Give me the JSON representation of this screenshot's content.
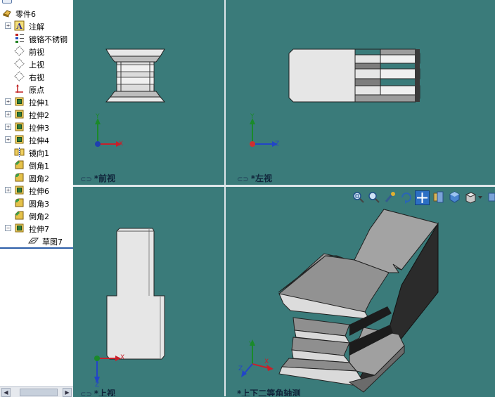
{
  "tree": {
    "items": [
      {
        "label": "零件6",
        "icon": "part-icon",
        "expander": ""
      },
      {
        "label": "注解",
        "icon": "annotation-icon",
        "expander": "+"
      },
      {
        "label": "镀铬不锈钢",
        "icon": "material-icon",
        "expander": ""
      },
      {
        "label": "前视",
        "icon": "plane-icon",
        "expander": ""
      },
      {
        "label": "上视",
        "icon": "plane-icon",
        "expander": ""
      },
      {
        "label": "右视",
        "icon": "plane-icon",
        "expander": ""
      },
      {
        "label": "原点",
        "icon": "origin-icon",
        "expander": ""
      },
      {
        "label": "拉伸1",
        "icon": "extrude-icon",
        "expander": "+"
      },
      {
        "label": "拉伸2",
        "icon": "extrude-icon",
        "expander": "+"
      },
      {
        "label": "拉伸3",
        "icon": "extrude-icon",
        "expander": "+"
      },
      {
        "label": "拉伸4",
        "icon": "extrude-icon",
        "expander": "+"
      },
      {
        "label": "镜向1",
        "icon": "mirror-icon",
        "expander": ""
      },
      {
        "label": "倒角1",
        "icon": "chamfer-icon",
        "expander": ""
      },
      {
        "label": "圆角2",
        "icon": "fillet-icon",
        "expander": ""
      },
      {
        "label": "拉伸6",
        "icon": "extrude-icon",
        "expander": "+"
      },
      {
        "label": "圆角3",
        "icon": "fillet-icon",
        "expander": ""
      },
      {
        "label": "倒角2",
        "icon": "chamfer-icon",
        "expander": ""
      },
      {
        "label": "拉伸7",
        "icon": "extrude-icon",
        "expander": "−"
      },
      {
        "label": "草图7",
        "icon": "sketch-icon",
        "expander": ""
      }
    ]
  },
  "viewports": {
    "front": {
      "label": "*前视",
      "axes": {
        "x": "X",
        "y": "Y"
      }
    },
    "left": {
      "label": "*左视",
      "axes": {
        "z": "Z",
        "y": "Y"
      }
    },
    "top": {
      "label": "*上视",
      "axes": {
        "x": "X",
        "z": "Z"
      }
    },
    "iso": {
      "label": "*上下二等角轴测",
      "axes": {
        "x": "X",
        "y": "Y",
        "z": "Z"
      }
    }
  },
  "toolbar": {
    "icons": [
      "zoom-to-fit-icon",
      "zoom-to-area-icon",
      "zoom-in-out-icon",
      "rotate-icon",
      "pan-icon",
      "section-view-icon",
      "view-orientation-icon",
      "display-style-icon"
    ]
  },
  "colors": {
    "viewport_bg": "#3a7b7a",
    "part_light": "#e4e4e4",
    "part_mid": "#a9a9a9",
    "part_dark": "#2f2f2f",
    "selection": "#2c5ea8"
  }
}
